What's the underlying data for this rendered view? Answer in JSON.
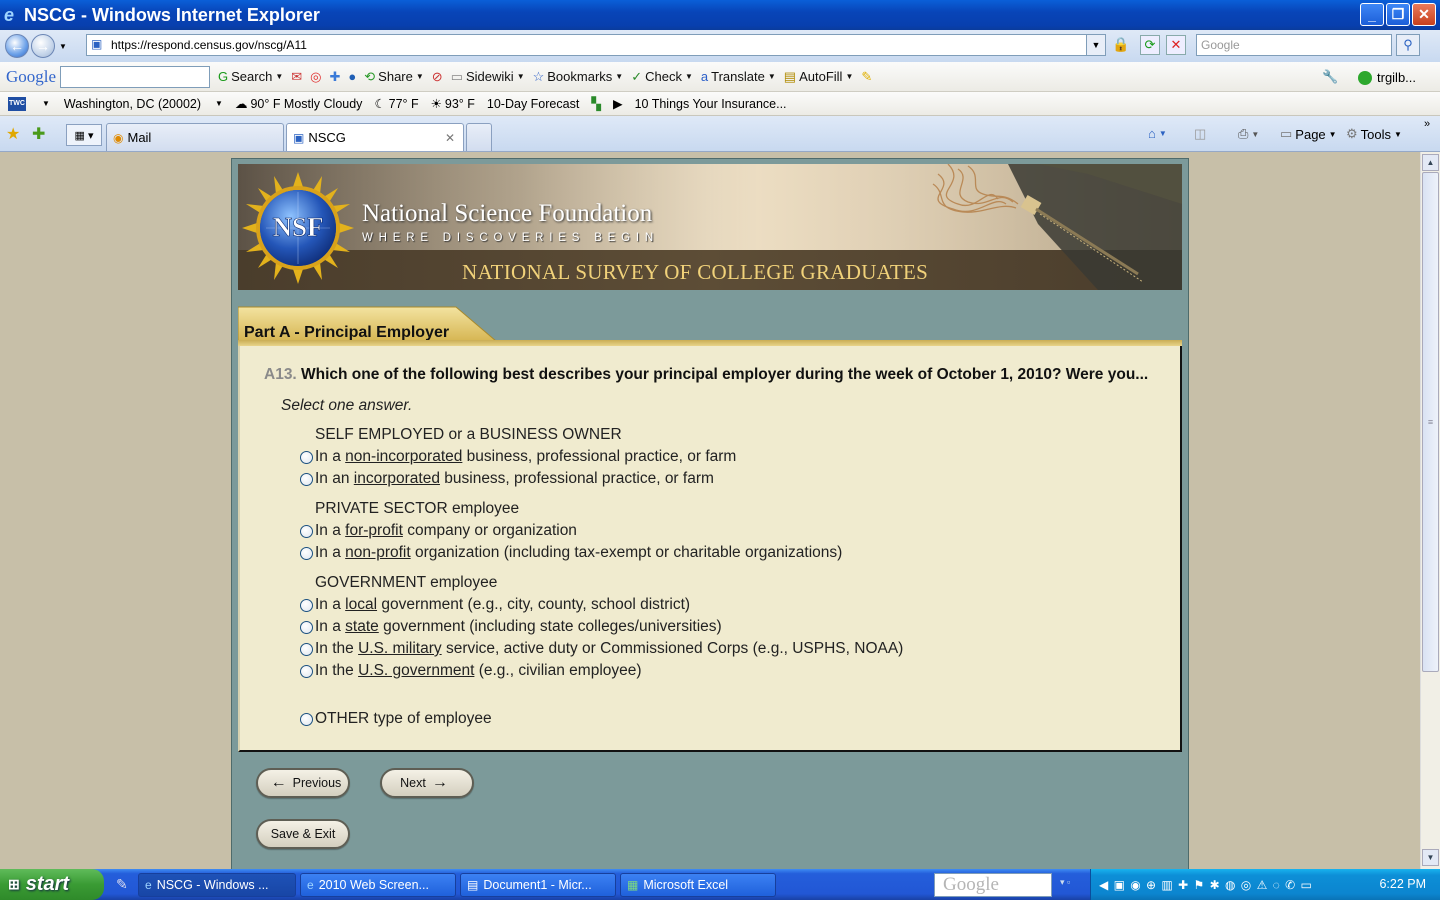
{
  "window": {
    "title": "NSCG - Windows Internet Explorer",
    "minimize": "_",
    "maximize": "❐",
    "close": "✕"
  },
  "address": {
    "url": "https://respond.census.gov/nscg/A11",
    "search_placeholder": "Google"
  },
  "google_toolbar": {
    "logo": "Google",
    "items": [
      {
        "label": "Search",
        "icon": "google-search-icon"
      },
      {
        "label": "Share",
        "icon": "share-icon"
      },
      {
        "label": "Sidewiki",
        "icon": "sidewiki-icon"
      },
      {
        "label": "Bookmarks",
        "icon": "star-icon"
      },
      {
        "label": "Check",
        "icon": "spellcheck-icon"
      },
      {
        "label": "Translate",
        "icon": "translate-icon"
      },
      {
        "label": "AutoFill",
        "icon": "autofill-icon"
      }
    ],
    "account": "trgilb..."
  },
  "weather_bar": {
    "logo": "TWC",
    "location": "Washington, DC (20002)",
    "items": [
      "90° F Mostly Cloudy",
      "77° F",
      "93° F",
      "10-Day Forecast",
      "10 Things Your Insurance..."
    ]
  },
  "tabs": {
    "mail": "Mail",
    "nscg": "NSCG"
  },
  "command_bar": {
    "page": "Page",
    "tools": "Tools"
  },
  "banner": {
    "org_name": "National Science Foundation",
    "tagline": "WHERE DISCOVERIES BEGIN",
    "seal_text": "NSF",
    "survey_title": "NATIONAL SURVEY OF COLLEGE GRADUATES"
  },
  "section": {
    "label": "Part A - Principal Employer"
  },
  "question": {
    "number": "A13.",
    "text": "Which one of the following best describes your principal employer during the week of October 1, 2010? Were you...",
    "instruction": "Select one answer.",
    "groups": [
      {
        "heading": "SELF EMPLOYED or a BUSINESS OWNER"
      },
      {
        "heading": "PRIVATE SECTOR employee"
      },
      {
        "heading": "GOVERNMENT employee"
      }
    ],
    "options": [
      {
        "pre": "In a ",
        "link": "non-incorporated",
        "post": " business, professional practice, or farm"
      },
      {
        "pre": "In an ",
        "link": "incorporated",
        "post": " business, professional practice, or farm"
      },
      {
        "pre": "In a ",
        "link": "for-profit",
        "post": " company or organization"
      },
      {
        "pre": "In a ",
        "link": "non-profit",
        "post": " organization (including tax-exempt or charitable organizations)"
      },
      {
        "pre": "In a ",
        "link": "local",
        "post": " government (e.g., city, county, school district)"
      },
      {
        "pre": "In a ",
        "link": "state",
        "post": " government (including state colleges/universities)"
      },
      {
        "pre": "In the ",
        "link": "U.S. military",
        "post": " service, active duty or Commissioned Corps (e.g., USPHS, NOAA)"
      },
      {
        "pre": "In the ",
        "link": "U.S. government",
        "post": " (e.g., civilian employee)"
      },
      {
        "pre": "OTHER type of employee",
        "link": "",
        "post": ""
      }
    ]
  },
  "buttons": {
    "previous": "Previous",
    "next": "Next",
    "save_exit": "Save & Exit"
  },
  "taskbar": {
    "start": "start",
    "items": [
      "NSCG - Windows ...",
      "2010 Web Screen...",
      "Document1 - Micr...",
      "Microsoft Excel"
    ],
    "search_logo": "Google",
    "clock": "6:22 PM"
  }
}
